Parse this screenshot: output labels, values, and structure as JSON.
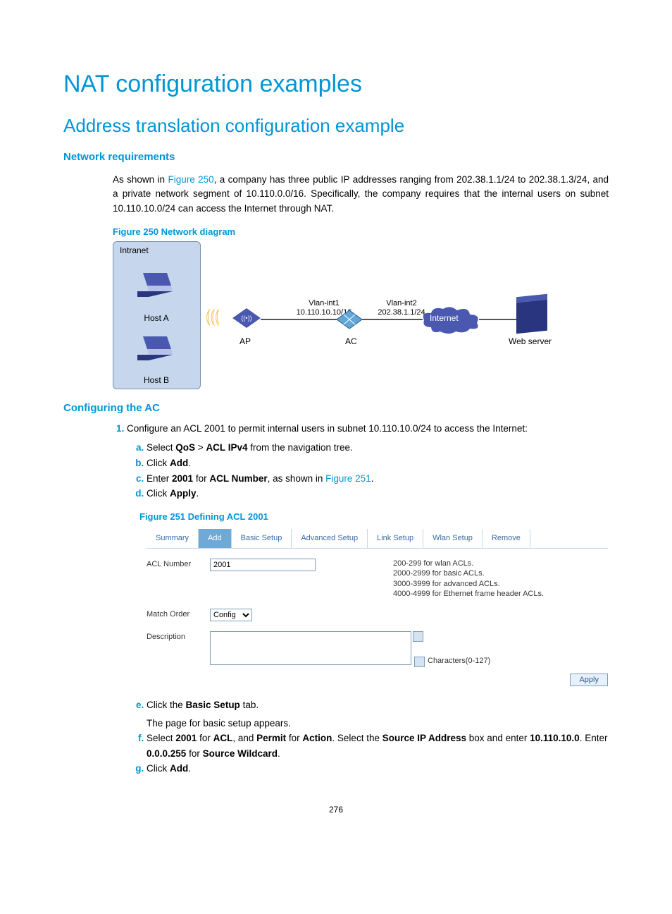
{
  "title": "NAT configuration examples",
  "subtitle": "Address translation configuration example",
  "network_req_heading": "Network requirements",
  "req_text_1": "As shown in ",
  "req_fig_link": "Figure 250",
  "req_text_2": ", a company has three public IP addresses ranging from 202.38.1.1/24 to 202.38.1.3/24, and a private network segment of 10.110.0.0/16. Specifically, the company requires that the internal users on subnet 10.110.10.0/24 can access the Internet through NAT.",
  "fig250_caption": "Figure 250 Network diagram",
  "diagram": {
    "intranet": "Intranet",
    "host_a": "Host A",
    "host_b": "Host B",
    "ap": "AP",
    "if1_name": "Vlan-int1",
    "if1_ip": "10.110.10.10/16",
    "ac": "AC",
    "if2_name": "Vlan-int2",
    "if2_ip": "202.38.1.1/24",
    "internet": "Internet",
    "webserver": "Web server"
  },
  "config_ac_heading": "Configuring the AC",
  "step1": "Configure an ACL 2001 to permit internal users in subnet 10.110.10.0/24 to access the Internet:",
  "step_a_1": "Select ",
  "step_a_b1": "QoS",
  "step_a_2": " > ",
  "step_a_b2": "ACL IPv4",
  "step_a_3": " from the navigation tree.",
  "step_b_1": "Click ",
  "step_b_b1": "Add",
  "step_b_2": ".",
  "step_c_1": "Enter ",
  "step_c_b1": "2001",
  "step_c_2": " for ",
  "step_c_b2": "ACL Number",
  "step_c_3": ", as shown in ",
  "step_c_link": "Figure 251",
  "step_c_4": ".",
  "step_d_1": "Click ",
  "step_d_b1": "Apply",
  "step_d_2": ".",
  "fig251_caption": "Figure 251 Defining ACL 2001",
  "tabs": [
    "Summary",
    "Add",
    "Basic Setup",
    "Advanced Setup",
    "Link Setup",
    "Wlan Setup",
    "Remove"
  ],
  "acl_number_label": "ACL Number",
  "acl_number_value": "2001",
  "acl_hints": [
    "200-299 for wlan ACLs.",
    "2000-2999 for basic ACLs.",
    "3000-3999 for advanced ACLs.",
    "4000-4999 for Ethernet frame header ACLs."
  ],
  "match_order_label": "Match Order",
  "match_order_value": "Config",
  "description_label": "Description",
  "chars_label": "Characters(0-127)",
  "apply_btn": "Apply",
  "step_e_1": "Click the ",
  "step_e_b1": "Basic Setup",
  "step_e_2": " tab.",
  "step_e_sub": "The page for basic setup appears.",
  "step_f_1": "Select ",
  "step_f_b1": "2001",
  "step_f_2": " for ",
  "step_f_b2": "ACL",
  "step_f_3": ", and ",
  "step_f_b3": "Permit",
  "step_f_4": " for ",
  "step_f_b4": "Action",
  "step_f_5": ". Select the ",
  "step_f_b5": "Source IP Address",
  "step_f_6": " box and enter ",
  "step_f_b6": "10.110.10.0",
  "step_f_7": ". Enter ",
  "step_f_b7": "0.0.0.255",
  "step_f_8": " for ",
  "step_f_b8": "Source Wildcard",
  "step_f_9": ".",
  "step_g_1": "Click ",
  "step_g_b1": "Add",
  "step_g_2": ".",
  "page_number": "276"
}
